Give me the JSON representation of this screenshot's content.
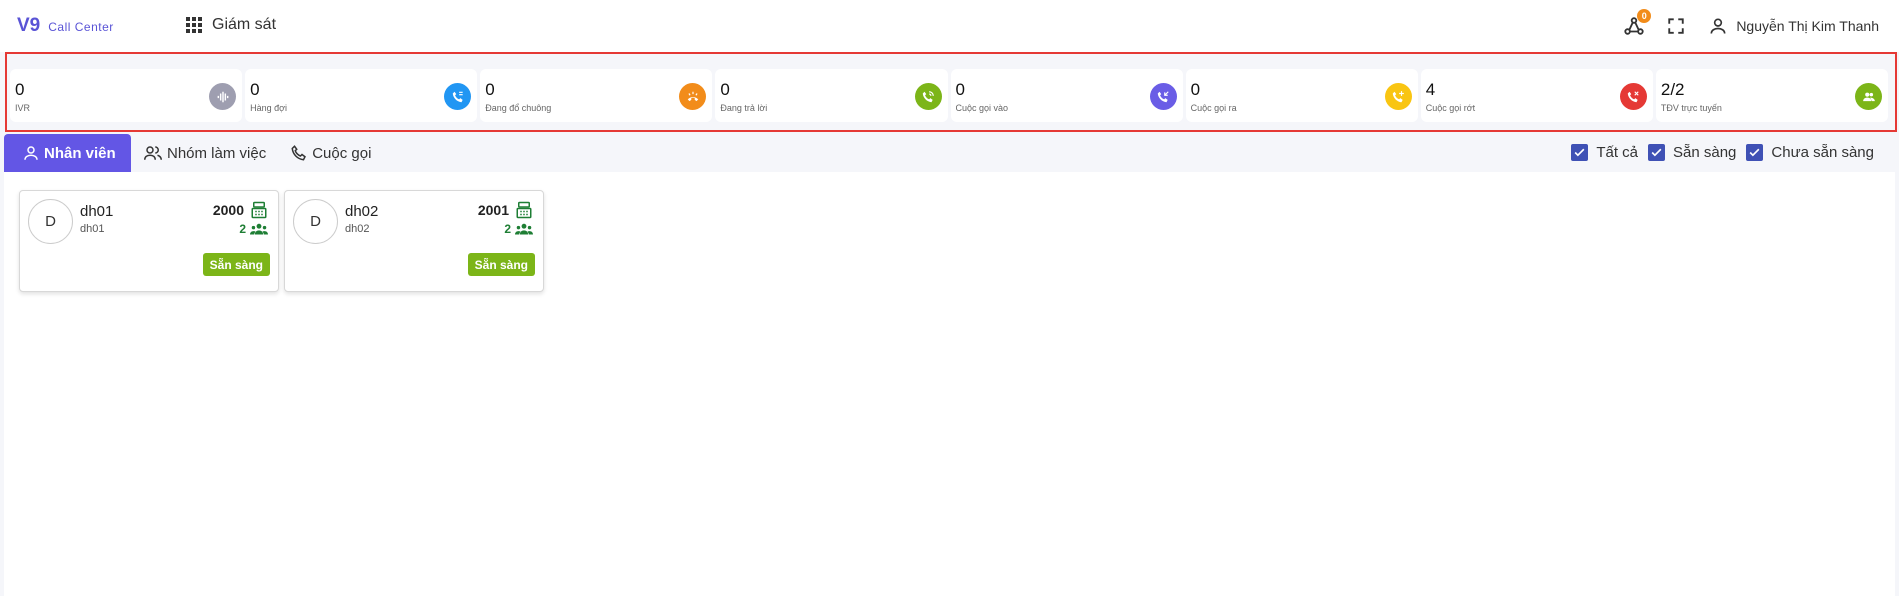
{
  "app": {
    "logo_main": "V9",
    "logo_sub": "Call Center"
  },
  "module": {
    "label": "Giám sát"
  },
  "header": {
    "notification_count": "0",
    "user_name": "Nguyễn Thị Kim Thanh"
  },
  "stats": [
    {
      "value": "0",
      "label": "IVR",
      "icon": "waveform-icon",
      "color": "#9e9eb0"
    },
    {
      "value": "0",
      "label": "Hàng đợi",
      "icon": "phone-queue-icon",
      "color": "#2196f3"
    },
    {
      "value": "0",
      "label": "Đang đổ chuông",
      "icon": "phone-ringing-icon",
      "color": "#f28c1a"
    },
    {
      "value": "0",
      "label": "Đang trả lời",
      "icon": "phone-in-talk-icon",
      "color": "#7cb518"
    },
    {
      "value": "0",
      "label": "Cuộc gọi vào",
      "icon": "phone-incoming-icon",
      "color": "#6a5de6"
    },
    {
      "value": "0",
      "label": "Cuộc gọi ra",
      "icon": "phone-outgoing-icon",
      "color": "#f9c512"
    },
    {
      "value": "4",
      "label": "Cuộc gọi rớt",
      "icon": "phone-missed-icon",
      "color": "#e53935"
    },
    {
      "value": "2/2",
      "label": "TĐV trực tuyến",
      "icon": "agents-online-icon",
      "color": "#7cb518"
    }
  ],
  "tabs": [
    {
      "label": "Nhân viên",
      "active": true
    },
    {
      "label": "Nhóm làm việc",
      "active": false
    },
    {
      "label": "Cuộc gọi",
      "active": false
    }
  ],
  "filters": [
    {
      "label": "Tất cả",
      "checked": true
    },
    {
      "label": "Sẵn sàng",
      "checked": true
    },
    {
      "label": "Chưa sẵn sàng",
      "checked": true
    }
  ],
  "agents": [
    {
      "initial": "D",
      "name": "dh01",
      "username": "dh01",
      "extension": "2000",
      "group_count": "2",
      "status": "Sẵn sàng",
      "status_color": "#7cb518"
    },
    {
      "initial": "D",
      "name": "dh02",
      "username": "dh02",
      "extension": "2001",
      "group_count": "2",
      "status": "Sẵn sàng",
      "status_color": "#7cb518"
    }
  ]
}
